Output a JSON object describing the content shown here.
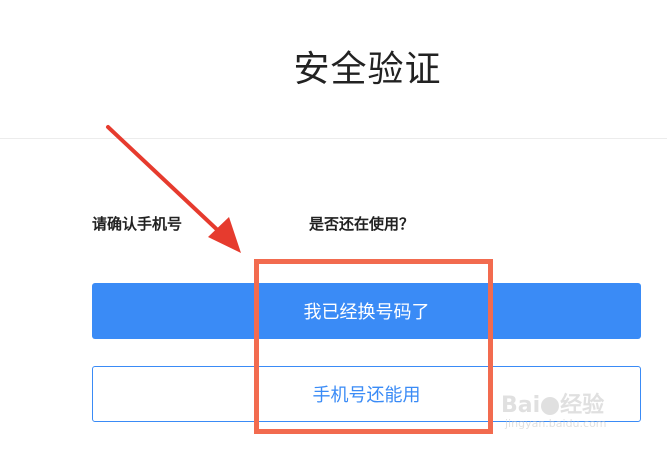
{
  "header": {
    "title": "安全验证"
  },
  "form": {
    "confirm_phone_label": "请确认手机号",
    "still_in_use_label": "是否还在使用？"
  },
  "buttons": {
    "changed_number_label": "我已经换号码了",
    "still_usable_label": "手机号还能用"
  },
  "annotation": {
    "highlight_color": "#f26b4f",
    "arrow_color": "#e63b2e"
  },
  "watermark": {
    "logo_left": "Bai",
    "logo_right": "经验",
    "url": "jingyan.baidu.com"
  },
  "colors": {
    "primary": "#3a8bf6",
    "title_text": "#222222"
  }
}
